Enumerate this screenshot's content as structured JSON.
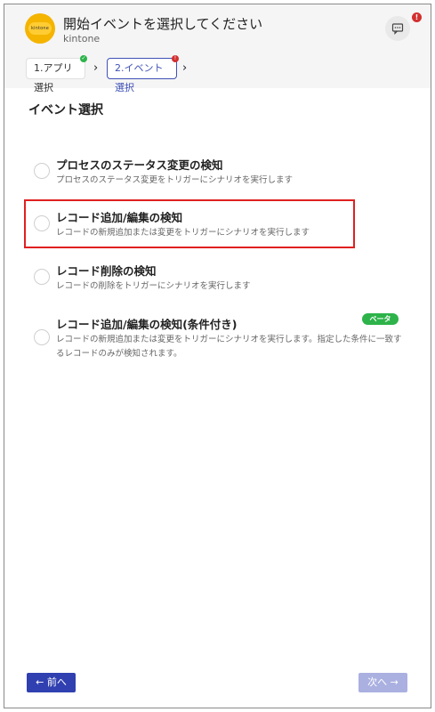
{
  "header": {
    "title": "開始イベントを選択してください",
    "subtitle": "kintone",
    "logo_text": "kintone",
    "alert_badge": "!"
  },
  "steps": [
    {
      "label": "1.アプリ選択",
      "status": "done",
      "status_glyph": "✓"
    },
    {
      "label": "2.イベント選択",
      "status": "error",
      "status_glyph": "!"
    }
  ],
  "chevron": "›",
  "section_title": "イベント選択",
  "options": [
    {
      "title": "プロセスのステータス変更の検知",
      "description": "プロセスのステータス変更をトリガーにシナリオを実行します"
    },
    {
      "title": "レコード追加/編集の検知",
      "description": "レコードの新規追加または変更をトリガーにシナリオを実行します"
    },
    {
      "title": "レコード削除の検知",
      "description": "レコードの削除をトリガーにシナリオを実行します"
    },
    {
      "title": "レコード追加/編集の検知(条件付き)",
      "badge": "ベータ",
      "description": "レコードの新規追加または変更をトリガーにシナリオを実行します。指定した条件に一致するレコードのみが検知されます。"
    }
  ],
  "footer": {
    "prev_label": "← 前へ",
    "next_label": "次へ →"
  },
  "colors": {
    "primary": "#3040b0",
    "primary_disabled": "#aab0e0",
    "success": "#2db34a",
    "danger": "#d32f2f",
    "highlight": "#e02020",
    "brand_yellow": "#f4b400"
  }
}
